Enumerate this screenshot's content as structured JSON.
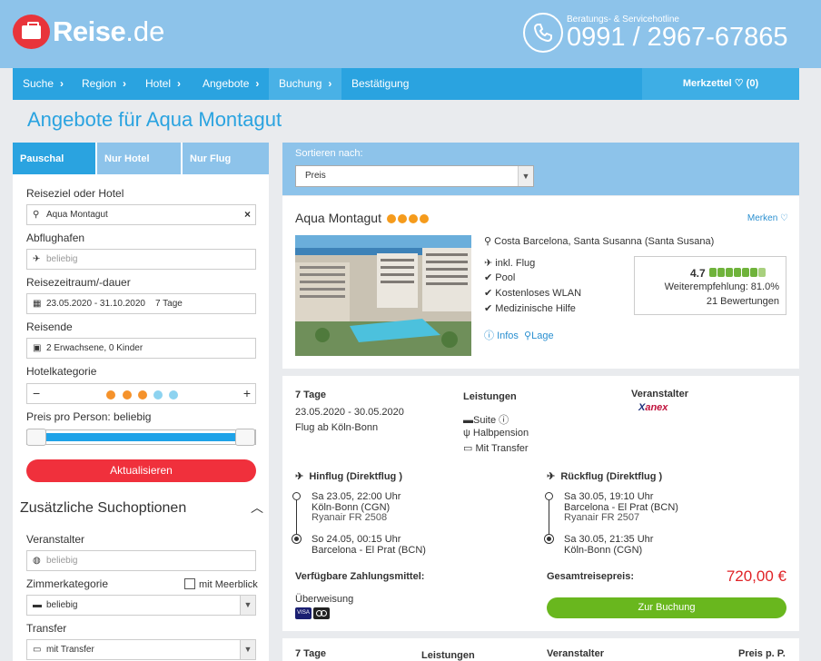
{
  "header": {
    "brand": "Reise",
    "tld": ".de",
    "hotline_label": "Beratungs- & Servicehotline",
    "hotline_number": "0991 / 2967-67865"
  },
  "nav": {
    "items": [
      "Suche",
      "Region",
      "Hotel",
      "Angebote",
      "Buchung",
      "Bestätigung"
    ],
    "merkzettel": "Merkzettel ♡ (0)"
  },
  "page": {
    "title": "Angebote für Aqua Montagut"
  },
  "sidebar": {
    "tabs": [
      "Pauschal",
      "Nur Hotel",
      "Nur Flug"
    ],
    "reiseziel_label": "Reiseziel oder Hotel",
    "reiseziel_value": "Aqua Montagut",
    "abflughafen_label": "Abflughafen",
    "abflughafen_value": "beliebig",
    "zeitraum_label": "Reisezeitraum/-dauer",
    "zeitraum_value": "23.05.2020 - 31.10.2020",
    "dauer_value": "7 Tage",
    "reisende_label": "Reisende",
    "reisende_value": "2 Erwachsene, 0 Kinder",
    "kategorie_label": "Hotelkategorie",
    "preis_label": "Preis pro Person: beliebig",
    "update_button": "Aktualisieren",
    "more_title": "Zusätzliche Suchoptionen",
    "veranstalter_label": "Veranstalter",
    "veranstalter_value": "beliebig",
    "zimmer_label": "Zimmerkategorie",
    "meerblick_label": "mit Meerblick",
    "zimmer_value": "beliebig",
    "transfer_label": "Transfer",
    "transfer_value": "mit Transfer"
  },
  "sort": {
    "label": "Sortieren nach:",
    "value": "Preis"
  },
  "hotel": {
    "name": "Aqua Montagut",
    "stars": 4,
    "merken": "Merken ♡",
    "location": "Costa Barcelona, Santa Susanna (Santa Susana)",
    "features": [
      "inkl. Flug",
      "Pool",
      "Kostenloses WLAN",
      "Medizinische Hilfe"
    ],
    "rating_score": "4.7",
    "recommend": "Weiterempfehlung: 81.0%",
    "reviews": "21 Bewertungen",
    "info_link": "Infos",
    "lage_link": "Lage"
  },
  "offer": {
    "duration": "7 Tage",
    "dates": "23.05.2020 - 30.05.2020",
    "flight_from": "Flug ab Köln-Bonn",
    "leistungen_title": "Leistungen",
    "leistungen": [
      "Suite",
      "Halbpension",
      "Mit Transfer"
    ],
    "veranstalter_title": "Veranstalter",
    "veranstalter_logo_text": "anex",
    "hinflug_title": "Hinflug (Direktflug )",
    "hin_dep_time": "Sa 23.05, 22:00 Uhr",
    "hin_dep_place": "Köln-Bonn (CGN)",
    "hin_flight": "Ryanair FR 2508",
    "hin_arr_time": "So 24.05, 00:15 Uhr",
    "hin_arr_place": "Barcelona - El Prat (BCN)",
    "rueckflug_title": "Rückflug (Direktflug )",
    "rue_dep_time": "Sa 30.05, 19:10 Uhr",
    "rue_dep_place": "Barcelona - El Prat (BCN)",
    "rue_flight": "Ryanair FR 2507",
    "rue_arr_time": "Sa 30.05, 21:35 Uhr",
    "rue_arr_place": "Köln-Bonn (CGN)",
    "zahlung_title": "Verfügbare Zahlungsmittel:",
    "zahlung_value": "Überweisung",
    "gesamt_title": "Gesamtreisepreis:",
    "price": "720,00 €",
    "book_button": "Zur Buchung"
  },
  "offer2": {
    "duration": "7 Tage",
    "leistungen_title": "Leistungen",
    "veranstalter_title": "Veranstalter",
    "preis_title": "Preis p. P."
  },
  "colors": {
    "header": "#8dc3ea",
    "nav": "#2aa3e0",
    "accent_red": "#f0303c",
    "price": "#e02327",
    "green": "#69b71e"
  }
}
